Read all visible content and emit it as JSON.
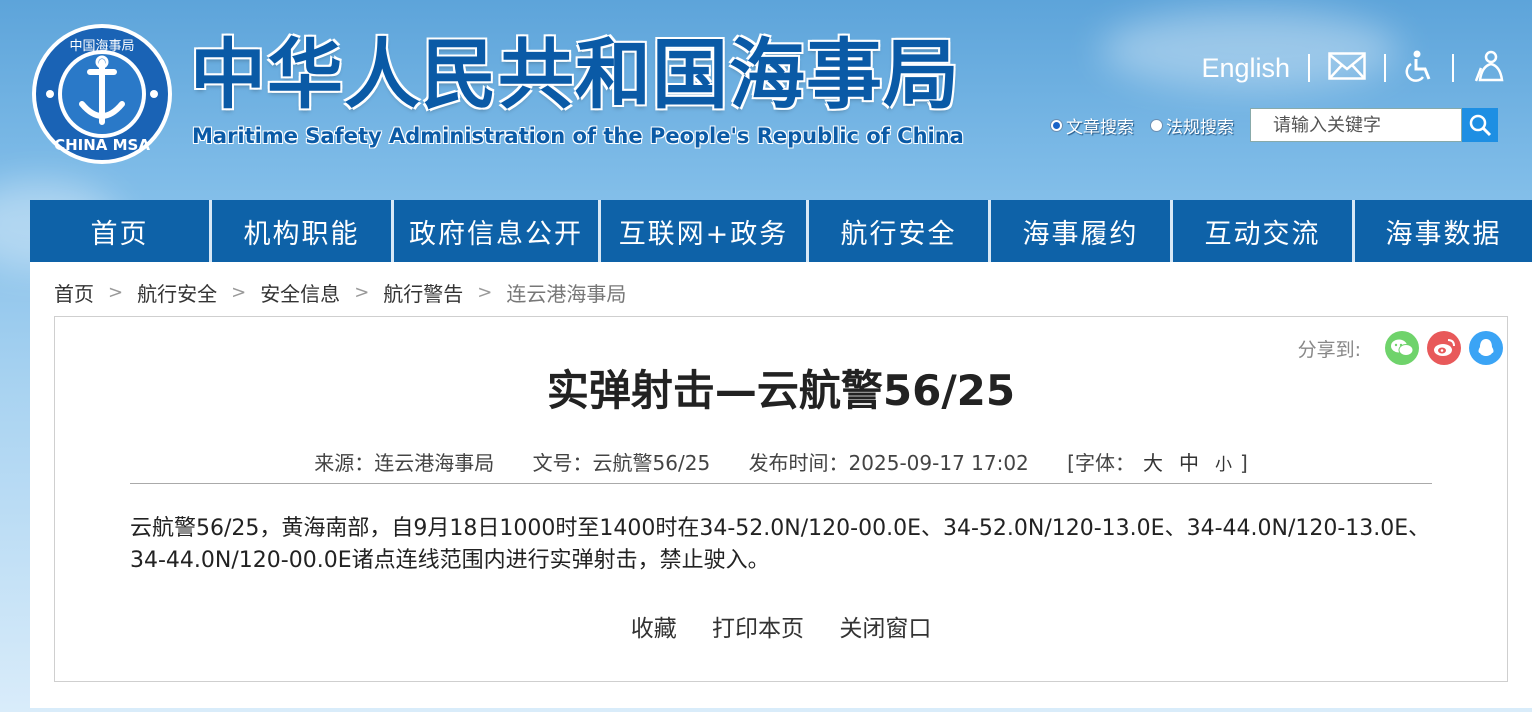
{
  "header": {
    "logo_top_text": "中国海事局",
    "logo_bottom_text": "CHINA MSA",
    "title_cn": "中华人民共和国海事局",
    "title_en": "Maritime Safety Administration of the People's Republic of China",
    "english_link": "English",
    "search": {
      "options": [
        "文章搜索",
        "法规搜索"
      ],
      "selected": "文章搜索",
      "placeholder": "请输入关键字",
      "value": ""
    }
  },
  "nav": {
    "items": [
      "首页",
      "机构职能",
      "政府信息公开",
      "互联网+政务",
      "航行安全",
      "海事履约",
      "互动交流",
      "海事数据"
    ]
  },
  "breadcrumb": [
    "首页",
    "航行安全",
    "安全信息",
    "航行警告",
    "连云港海事局"
  ],
  "article": {
    "share_label": "分享到:",
    "title": "实弹射击—云航警56/25",
    "source": "来源：连云港海事局",
    "doc_no": "文号：云航警56/25",
    "publish_time": "发布时间：2025-09-17 17:02",
    "font_size_label": "[字体：",
    "font_sizes": [
      "大",
      "中",
      "小"
    ],
    "font_size_close": "]",
    "body": "云航警56/25，黄海南部，自9月18日1000时至1400时在34-52.0N/120-00.0E、34-52.0N/120-13.0E、34-44.0N/120-13.0E、34-44.0N/120-00.0E诸点连线范围内进行实弹射击，禁止驶入。",
    "actions": [
      "收藏",
      "打印本页",
      "关闭窗口"
    ]
  },
  "colors": {
    "nav_bg": "#0e62a8",
    "title_blue": "#0a5aa6",
    "wechat": "#6fd36b",
    "weibo": "#e8595a",
    "qq": "#3ba4f5"
  }
}
